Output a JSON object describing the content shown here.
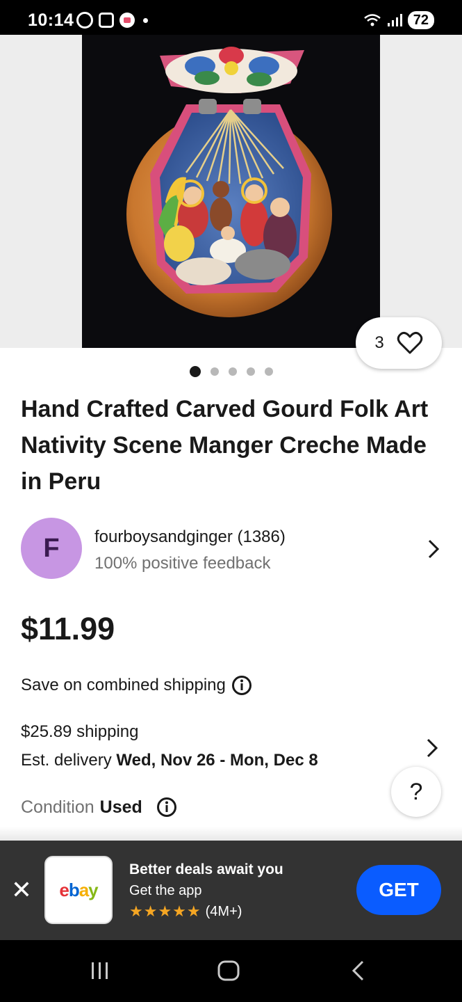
{
  "status_bar": {
    "time": "10:14",
    "battery": "72"
  },
  "listing": {
    "favorite_count": "3",
    "image_count": 5,
    "active_image_index": 1,
    "title": "Hand Crafted Carved Gourd Folk Art Nativity Scene Manger Creche Made in Peru"
  },
  "seller": {
    "avatar_letter": "F",
    "name": "fourboysandginger (1386)",
    "feedback": "100% positive feedback"
  },
  "pricing": {
    "price": "$11.99",
    "combined_shipping": "Save on combined shipping",
    "shipping": "$25.89 shipping",
    "delivery_label": "Est. delivery",
    "delivery_dates": "Wed, Nov 26 - Mon, Dec 8",
    "condition_label": "Condition",
    "condition_value": "Used",
    "help_glyph": "?"
  },
  "app_banner": {
    "close_glyph": "✕",
    "title": "Better deals await you",
    "subtitle": "Get the app",
    "stars": "★★★★★",
    "rating_count": "(4M+)",
    "get_label": "GET",
    "logo_letters": [
      "e",
      "b",
      "a",
      "y"
    ]
  },
  "colors": {
    "ebay_e": "#e53238",
    "ebay_b": "#0064d2",
    "ebay_a": "#f5af02",
    "ebay_y": "#86b817",
    "get_button": "#0a5cff",
    "avatar_bg": "#c796e3"
  },
  "icons": [
    "heart-outline-icon",
    "info-icon",
    "chevron-right-icon",
    "close-icon",
    "recents-icon",
    "home-icon",
    "back-icon"
  ]
}
